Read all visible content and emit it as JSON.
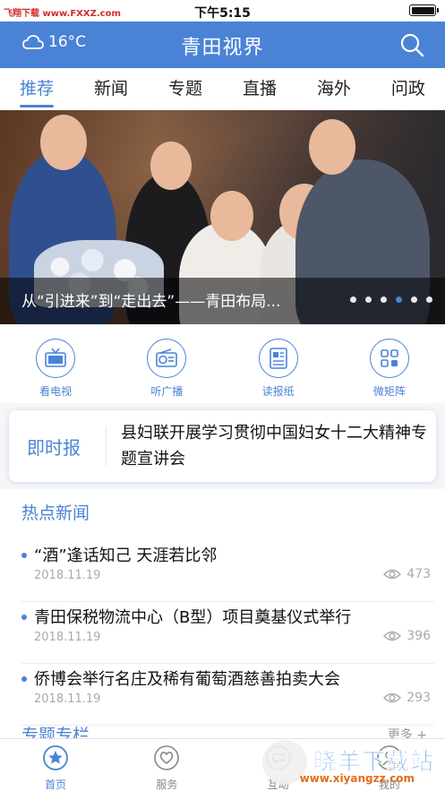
{
  "status_bar": {
    "watermark": "飞翔下载 www.FXXZ.com",
    "time": "下午5:15"
  },
  "header": {
    "temperature": "16°C",
    "title": "青田视界"
  },
  "tabs": [
    {
      "label": "推荐",
      "active": true
    },
    {
      "label": "新闻",
      "active": false
    },
    {
      "label": "专题",
      "active": false
    },
    {
      "label": "直播",
      "active": false
    },
    {
      "label": "海外",
      "active": false
    },
    {
      "label": "问政",
      "active": false
    }
  ],
  "banner": {
    "caption": "从“引进来”到“走出去”——青田布局...",
    "slide_count": 6,
    "active_slide": 4
  },
  "quick_menu": [
    {
      "label": "看电视",
      "icon": "tv-icon"
    },
    {
      "label": "听广播",
      "icon": "radio-icon"
    },
    {
      "label": "读报纸",
      "icon": "newspaper-icon"
    },
    {
      "label": "微矩阵",
      "icon": "grid-icon"
    }
  ],
  "flash": {
    "label": "即时报",
    "text": "县妇联开展学习贯彻中国妇女十二大精神专题宣讲会"
  },
  "hot_news": {
    "title": "热点新闻",
    "items": [
      {
        "title": "“酒”逢话知己 天涯若比邻",
        "date": "2018.11.19",
        "views": "473"
      },
      {
        "title": "青田保税物流中心（B型）项目奠基仪式举行",
        "date": "2018.11.19",
        "views": "396"
      },
      {
        "title": "侨博会举行名庄及稀有葡萄酒慈善拍卖大会",
        "date": "2018.11.19",
        "views": "293"
      }
    ]
  },
  "topics": {
    "title": "专题专栏",
    "more": "更多 +"
  },
  "bottom_nav": [
    {
      "label": "首页",
      "icon": "star-icon",
      "active": true
    },
    {
      "label": "服务",
      "icon": "heart-icon",
      "active": false
    },
    {
      "label": "互动",
      "icon": "chat-icon",
      "active": false
    },
    {
      "label": "我的",
      "icon": "user-icon",
      "active": false
    }
  ],
  "watermark_bottom": {
    "main": "晓羊下载站",
    "sub": "www.xiyangzz.com"
  },
  "colors": {
    "accent": "#4a83d6",
    "text": "#222222",
    "muted": "#aaaaaa"
  }
}
